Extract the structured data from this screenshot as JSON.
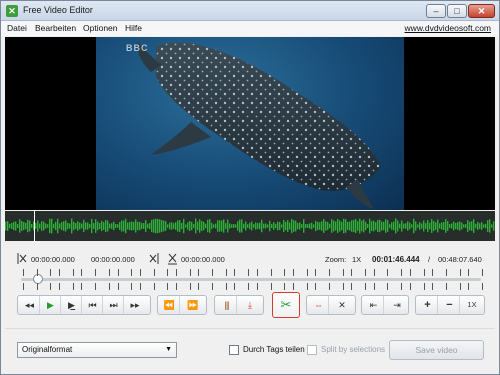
{
  "window": {
    "title": "Free Video Editor",
    "minimize": "–",
    "maximize": "□",
    "close": "✕"
  },
  "menu": {
    "items": [
      "Datei",
      "Bearbeiten",
      "Optionen",
      "Hilfe"
    ],
    "link": "www.dvdvideosoft.com"
  },
  "video": {
    "logo": "BBC"
  },
  "timeline": {
    "start_time": "00:00:00.000",
    "end_time": "00:00:00.000",
    "cut_time": "00:00:00.000",
    "zoom_label": "Zoom:",
    "zoom_value": "1X",
    "current_time": "00:01:46.444",
    "separator": "/",
    "total_time": "00:48:07.640",
    "position": 0.005
  },
  "controls": {
    "icons": [
      "step-back-icon",
      "play-icon",
      "play-to-end-icon",
      "prev-frame-icon",
      "next-frame-icon",
      "step-forward-icon",
      "goto-start-icon",
      "goto-end-icon",
      "add-marker-icon",
      "delete-marker-icon",
      "cut-icon",
      "split-icon",
      "remove-segment-icon",
      "prev-segment-icon",
      "next-segment-icon",
      "zoom-in-icon",
      "zoom-out-icon"
    ],
    "zoom_reset": "1X"
  },
  "bottom": {
    "format_value": "Originalformat",
    "split_by_tags_label": "Durch Tags teilen",
    "split_by_selections_label": "Split by selections",
    "save_label": "Save video"
  },
  "colors": {
    "accent_green": "#2a9a2a",
    "accent_red": "#d13b2b",
    "video_bg": "#000000"
  }
}
